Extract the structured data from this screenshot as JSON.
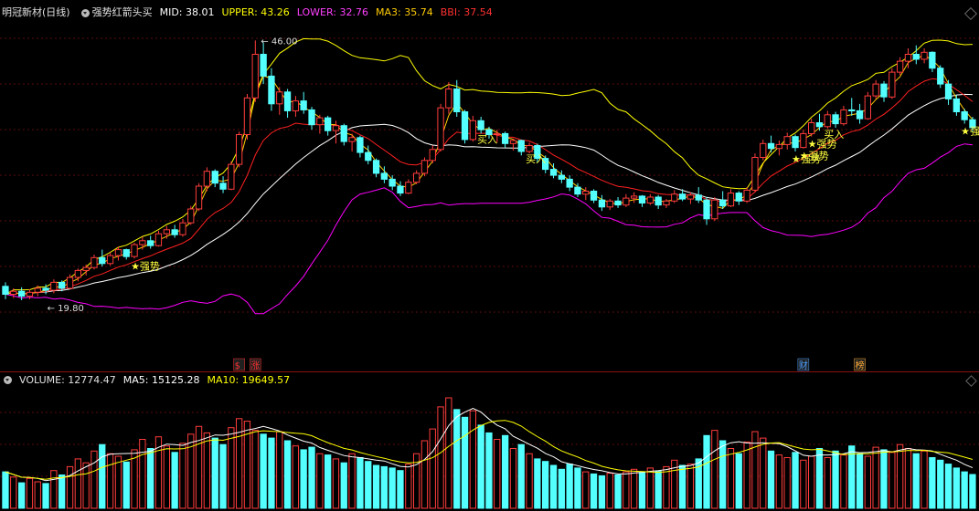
{
  "header": {
    "stock_name": "明冠新材(日线)",
    "indicator_name": "强势红箭头买",
    "mid_label": "MID: 38.01",
    "upper_label": "UPPER: 43.26",
    "lower_label": "LOWER: 32.76",
    "ma3_label": "MA3: 35.74",
    "bbi_label": "BBI: 37.54"
  },
  "volume_header": {
    "volume_label": "VOLUME: 12774.47",
    "ma5_label": "MA5: 15125.28",
    "ma10_label": "MA10: 19649.57"
  },
  "colors": {
    "background": "#000000",
    "up": "#ff3c3c",
    "down": "#54ffff",
    "mid": "#ffffff",
    "upper": "#ffff00",
    "lower": "#ff00ff",
    "ma3": "#ffcc00",
    "bbi": "#ff2020",
    "separator": "#8a1212"
  },
  "chart_data": [
    {
      "type": "candlestick",
      "high_marker": "46.00",
      "low_marker": "19.80",
      "ohlc": [
        [
          21.2,
          21.6,
          19.9,
          20.4
        ],
        [
          20.4,
          21.0,
          20.0,
          20.7
        ],
        [
          20.7,
          21.1,
          19.8,
          20.2
        ],
        [
          20.2,
          20.9,
          19.9,
          20.6
        ],
        [
          20.6,
          21.3,
          20.2,
          21.0
        ],
        [
          21.0,
          21.4,
          20.4,
          20.8
        ],
        [
          20.8,
          21.9,
          20.5,
          21.6
        ],
        [
          21.6,
          21.8,
          20.7,
          21.0
        ],
        [
          21.0,
          22.4,
          20.9,
          22.1
        ],
        [
          22.1,
          23.0,
          21.7,
          22.8
        ],
        [
          22.8,
          23.4,
          22.3,
          23.1
        ],
        [
          23.1,
          24.4,
          22.9,
          24.1
        ],
        [
          24.1,
          24.9,
          23.2,
          23.5
        ],
        [
          23.5,
          24.6,
          23.3,
          24.3
        ],
        [
          24.3,
          25.2,
          23.8,
          24.9
        ],
        [
          24.9,
          25.0,
          23.9,
          24.2
        ],
        [
          24.2,
          25.6,
          24.0,
          25.4
        ],
        [
          25.4,
          26.2,
          24.9,
          25.8
        ],
        [
          25.8,
          26.3,
          25.0,
          25.3
        ],
        [
          25.3,
          26.8,
          25.2,
          26.5
        ],
        [
          26.5,
          27.3,
          26.0,
          26.9
        ],
        [
          26.9,
          27.4,
          26.1,
          26.4
        ],
        [
          26.4,
          28.0,
          26.2,
          27.6
        ],
        [
          27.6,
          29.3,
          27.4,
          29.0
        ],
        [
          29.0,
          31.6,
          28.8,
          31.3
        ],
        [
          31.3,
          33.2,
          30.8,
          32.8
        ],
        [
          32.8,
          33.0,
          31.2,
          31.6
        ],
        [
          31.6,
          32.3,
          30.6,
          31.0
        ],
        [
          31.0,
          33.8,
          30.9,
          33.5
        ],
        [
          33.5,
          36.8,
          33.2,
          36.5
        ],
        [
          36.5,
          40.6,
          36.0,
          40.2
        ],
        [
          40.2,
          46.0,
          39.8,
          44.6
        ],
        [
          44.6,
          45.8,
          41.6,
          42.4
        ],
        [
          42.4,
          43.2,
          38.9,
          39.6
        ],
        [
          39.6,
          41.3,
          38.5,
          40.8
        ],
        [
          40.8,
          41.1,
          38.2,
          38.9
        ],
        [
          38.9,
          40.4,
          38.3,
          39.9
        ],
        [
          39.9,
          40.8,
          38.6,
          39.0
        ],
        [
          39.0,
          39.3,
          37.0,
          37.5
        ],
        [
          37.5,
          38.5,
          36.6,
          38.2
        ],
        [
          38.2,
          38.4,
          36.4,
          36.9
        ],
        [
          36.9,
          37.9,
          35.6,
          37.4
        ],
        [
          37.4,
          37.6,
          35.4,
          35.8
        ],
        [
          35.8,
          36.6,
          34.8,
          36.2
        ],
        [
          36.2,
          36.4,
          34.2,
          34.7
        ],
        [
          34.7,
          35.4,
          33.5,
          33.9
        ],
        [
          33.9,
          34.1,
          32.2,
          32.6
        ],
        [
          32.6,
          33.3,
          31.6,
          32.0
        ],
        [
          32.0,
          32.4,
          30.9,
          31.3
        ],
        [
          31.3,
          31.8,
          30.3,
          30.6
        ],
        [
          30.6,
          32.0,
          30.5,
          31.7
        ],
        [
          31.7,
          32.9,
          31.5,
          32.6
        ],
        [
          32.6,
          34.2,
          32.3,
          33.9
        ],
        [
          33.9,
          35.4,
          33.6,
          35.0
        ],
        [
          35.0,
          39.6,
          34.8,
          39.2
        ],
        [
          39.2,
          41.8,
          38.6,
          41.1
        ],
        [
          41.1,
          42.0,
          38.3,
          38.8
        ],
        [
          38.8,
          39.0,
          35.6,
          36.0
        ],
        [
          36.0,
          38.4,
          35.8,
          37.9
        ],
        [
          37.9,
          38.3,
          36.6,
          37.0
        ],
        [
          37.0,
          37.3,
          36.1,
          36.5
        ],
        [
          36.5,
          37.0,
          35.7,
          36.6
        ],
        [
          36.6,
          36.8,
          35.2,
          35.6
        ],
        [
          35.6,
          36.1,
          34.9,
          35.9
        ],
        [
          35.9,
          36.0,
          34.4,
          34.8
        ],
        [
          34.8,
          35.7,
          34.6,
          35.4
        ],
        [
          35.4,
          35.6,
          33.7,
          34.1
        ],
        [
          34.1,
          34.4,
          32.6,
          33.0
        ],
        [
          33.0,
          33.6,
          32.1,
          32.4
        ],
        [
          32.4,
          32.9,
          31.6,
          32.0
        ],
        [
          32.0,
          32.4,
          30.8,
          31.2
        ],
        [
          31.2,
          31.6,
          30.2,
          30.5
        ],
        [
          30.5,
          31.2,
          29.9,
          30.8
        ],
        [
          30.8,
          31.0,
          29.6,
          29.9
        ],
        [
          29.9,
          30.4,
          28.8,
          29.2
        ],
        [
          29.2,
          30.0,
          28.9,
          29.8
        ],
        [
          29.8,
          30.2,
          29.1,
          29.4
        ],
        [
          29.4,
          30.5,
          29.2,
          30.1
        ],
        [
          30.1,
          30.7,
          29.6,
          30.3
        ],
        [
          30.3,
          30.4,
          29.2,
          29.6
        ],
        [
          29.6,
          30.5,
          29.4,
          30.2
        ],
        [
          30.2,
          30.4,
          29.0,
          29.4
        ],
        [
          29.4,
          30.0,
          29.1,
          29.8
        ],
        [
          29.8,
          30.9,
          29.6,
          30.5
        ],
        [
          30.5,
          31.0,
          29.8,
          30.0
        ],
        [
          30.0,
          30.7,
          29.5,
          30.4
        ],
        [
          30.4,
          31.2,
          29.6,
          29.9
        ],
        [
          29.9,
          30.2,
          27.4,
          28.0
        ],
        [
          28.0,
          30.2,
          27.8,
          29.9
        ],
        [
          29.9,
          30.8,
          29.0,
          29.3
        ],
        [
          29.3,
          31.0,
          29.2,
          30.6
        ],
        [
          30.6,
          30.8,
          29.4,
          29.8
        ],
        [
          29.8,
          31.2,
          29.6,
          30.9
        ],
        [
          30.9,
          34.6,
          30.7,
          34.2
        ],
        [
          34.2,
          36.0,
          33.9,
          35.6
        ],
        [
          35.6,
          36.4,
          34.7,
          35.1
        ],
        [
          35.1,
          35.9,
          34.4,
          35.5
        ],
        [
          35.5,
          36.7,
          35.0,
          36.3
        ],
        [
          36.3,
          36.5,
          34.8,
          35.2
        ],
        [
          35.2,
          37.0,
          35.1,
          36.6
        ],
        [
          36.6,
          38.1,
          36.3,
          37.7
        ],
        [
          37.7,
          38.6,
          36.9,
          37.3
        ],
        [
          37.3,
          38.9,
          37.1,
          38.5
        ],
        [
          38.5,
          38.8,
          37.2,
          37.6
        ],
        [
          37.6,
          39.4,
          37.4,
          39.0
        ],
        [
          39.0,
          40.2,
          38.4,
          38.9
        ],
        [
          38.9,
          39.6,
          37.6,
          38.1
        ],
        [
          38.1,
          40.8,
          38.0,
          40.4
        ],
        [
          40.4,
          42.0,
          40.1,
          41.6
        ],
        [
          41.6,
          41.9,
          39.8,
          40.3
        ],
        [
          40.3,
          43.2,
          40.1,
          42.8
        ],
        [
          42.8,
          44.3,
          42.5,
          43.9
        ],
        [
          43.9,
          45.2,
          43.2,
          44.6
        ],
        [
          44.6,
          45.5,
          43.6,
          44.1
        ],
        [
          44.1,
          45.2,
          43.7,
          44.8
        ],
        [
          44.8,
          44.9,
          42.8,
          43.2
        ],
        [
          43.2,
          43.5,
          41.2,
          41.6
        ],
        [
          41.6,
          42.0,
          39.5,
          40.1
        ],
        [
          40.1,
          40.5,
          38.4,
          38.8
        ],
        [
          38.8,
          39.1,
          37.6,
          38.0
        ],
        [
          38.0,
          38.3,
          36.8,
          37.2
        ]
      ],
      "annotations": [
        "★强势",
        "买入",
        "买入",
        "★强势",
        "★强势",
        "★强势",
        "买入",
        "★强势"
      ],
      "event_tags": [
        "$",
        "涨",
        "财",
        "榜"
      ]
    },
    {
      "type": "bar",
      "volume": [
        14000,
        12000,
        9800,
        11500,
        10200,
        9500,
        14500,
        12800,
        16000,
        19000,
        17500,
        22000,
        24500,
        21000,
        20000,
        17800,
        22500,
        26500,
        23000,
        27500,
        24000,
        21500,
        25000,
        28500,
        31500,
        29000,
        27000,
        24500,
        31000,
        34500,
        33500,
        30000,
        28500,
        27000,
        29500,
        26000,
        24000,
        22500,
        23500,
        21000,
        20500,
        19000,
        17500,
        21000,
        19500,
        18000,
        16500,
        16000,
        15500,
        14500,
        17000,
        21000,
        26000,
        30500,
        39000,
        42500,
        38000,
        35000,
        37500,
        32000,
        29000,
        26500,
        28000,
        23000,
        24500,
        21000,
        19000,
        18000,
        16500,
        15000,
        17000,
        15500,
        14000,
        13200,
        12500,
        13500,
        12800,
        14000,
        15000,
        13800,
        15500,
        14200,
        16000,
        18500,
        16500,
        17000,
        19000,
        28000,
        30000,
        26000,
        23000,
        21000,
        25500,
        29500,
        27000,
        22000,
        20500,
        19500,
        21500,
        18500,
        20000,
        23000,
        19500,
        22000,
        20500,
        24000,
        21000,
        20000,
        23500,
        22500,
        21500,
        24500,
        23000,
        21000,
        22000,
        19500,
        18500,
        17000,
        15500,
        14000,
        13000
      ]
    }
  ]
}
